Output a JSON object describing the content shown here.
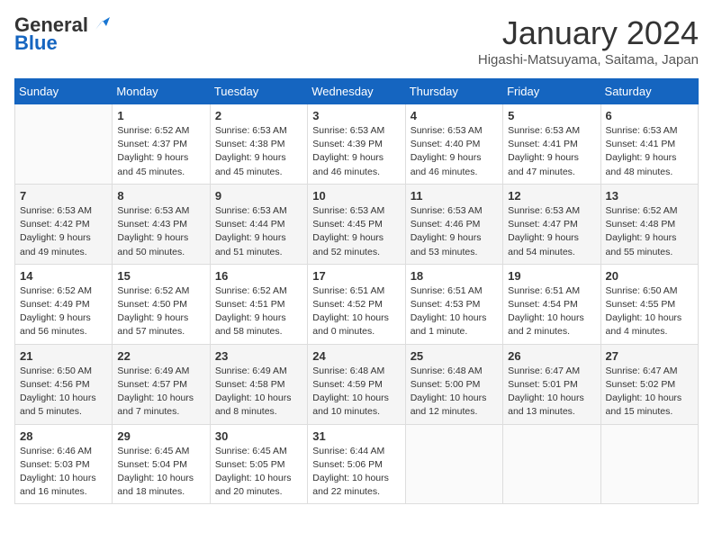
{
  "logo": {
    "line1": "General",
    "line2": "Blue"
  },
  "title": "January 2024",
  "location": "Higashi-Matsuyama, Saitama, Japan",
  "days_of_week": [
    "Sunday",
    "Monday",
    "Tuesday",
    "Wednesday",
    "Thursday",
    "Friday",
    "Saturday"
  ],
  "weeks": [
    [
      {
        "day": "",
        "info": ""
      },
      {
        "day": "1",
        "info": "Sunrise: 6:52 AM\nSunset: 4:37 PM\nDaylight: 9 hours\nand 45 minutes."
      },
      {
        "day": "2",
        "info": "Sunrise: 6:53 AM\nSunset: 4:38 PM\nDaylight: 9 hours\nand 45 minutes."
      },
      {
        "day": "3",
        "info": "Sunrise: 6:53 AM\nSunset: 4:39 PM\nDaylight: 9 hours\nand 46 minutes."
      },
      {
        "day": "4",
        "info": "Sunrise: 6:53 AM\nSunset: 4:40 PM\nDaylight: 9 hours\nand 46 minutes."
      },
      {
        "day": "5",
        "info": "Sunrise: 6:53 AM\nSunset: 4:41 PM\nDaylight: 9 hours\nand 47 minutes."
      },
      {
        "day": "6",
        "info": "Sunrise: 6:53 AM\nSunset: 4:41 PM\nDaylight: 9 hours\nand 48 minutes."
      }
    ],
    [
      {
        "day": "7",
        "info": "Sunrise: 6:53 AM\nSunset: 4:42 PM\nDaylight: 9 hours\nand 49 minutes."
      },
      {
        "day": "8",
        "info": "Sunrise: 6:53 AM\nSunset: 4:43 PM\nDaylight: 9 hours\nand 50 minutes."
      },
      {
        "day": "9",
        "info": "Sunrise: 6:53 AM\nSunset: 4:44 PM\nDaylight: 9 hours\nand 51 minutes."
      },
      {
        "day": "10",
        "info": "Sunrise: 6:53 AM\nSunset: 4:45 PM\nDaylight: 9 hours\nand 52 minutes."
      },
      {
        "day": "11",
        "info": "Sunrise: 6:53 AM\nSunset: 4:46 PM\nDaylight: 9 hours\nand 53 minutes."
      },
      {
        "day": "12",
        "info": "Sunrise: 6:53 AM\nSunset: 4:47 PM\nDaylight: 9 hours\nand 54 minutes."
      },
      {
        "day": "13",
        "info": "Sunrise: 6:52 AM\nSunset: 4:48 PM\nDaylight: 9 hours\nand 55 minutes."
      }
    ],
    [
      {
        "day": "14",
        "info": "Sunrise: 6:52 AM\nSunset: 4:49 PM\nDaylight: 9 hours\nand 56 minutes."
      },
      {
        "day": "15",
        "info": "Sunrise: 6:52 AM\nSunset: 4:50 PM\nDaylight: 9 hours\nand 57 minutes."
      },
      {
        "day": "16",
        "info": "Sunrise: 6:52 AM\nSunset: 4:51 PM\nDaylight: 9 hours\nand 58 minutes."
      },
      {
        "day": "17",
        "info": "Sunrise: 6:51 AM\nSunset: 4:52 PM\nDaylight: 10 hours\nand 0 minutes."
      },
      {
        "day": "18",
        "info": "Sunrise: 6:51 AM\nSunset: 4:53 PM\nDaylight: 10 hours\nand 1 minute."
      },
      {
        "day": "19",
        "info": "Sunrise: 6:51 AM\nSunset: 4:54 PM\nDaylight: 10 hours\nand 2 minutes."
      },
      {
        "day": "20",
        "info": "Sunrise: 6:50 AM\nSunset: 4:55 PM\nDaylight: 10 hours\nand 4 minutes."
      }
    ],
    [
      {
        "day": "21",
        "info": "Sunrise: 6:50 AM\nSunset: 4:56 PM\nDaylight: 10 hours\nand 5 minutes."
      },
      {
        "day": "22",
        "info": "Sunrise: 6:49 AM\nSunset: 4:57 PM\nDaylight: 10 hours\nand 7 minutes."
      },
      {
        "day": "23",
        "info": "Sunrise: 6:49 AM\nSunset: 4:58 PM\nDaylight: 10 hours\nand 8 minutes."
      },
      {
        "day": "24",
        "info": "Sunrise: 6:48 AM\nSunset: 4:59 PM\nDaylight: 10 hours\nand 10 minutes."
      },
      {
        "day": "25",
        "info": "Sunrise: 6:48 AM\nSunset: 5:00 PM\nDaylight: 10 hours\nand 12 minutes."
      },
      {
        "day": "26",
        "info": "Sunrise: 6:47 AM\nSunset: 5:01 PM\nDaylight: 10 hours\nand 13 minutes."
      },
      {
        "day": "27",
        "info": "Sunrise: 6:47 AM\nSunset: 5:02 PM\nDaylight: 10 hours\nand 15 minutes."
      }
    ],
    [
      {
        "day": "28",
        "info": "Sunrise: 6:46 AM\nSunset: 5:03 PM\nDaylight: 10 hours\nand 16 minutes."
      },
      {
        "day": "29",
        "info": "Sunrise: 6:45 AM\nSunset: 5:04 PM\nDaylight: 10 hours\nand 18 minutes."
      },
      {
        "day": "30",
        "info": "Sunrise: 6:45 AM\nSunset: 5:05 PM\nDaylight: 10 hours\nand 20 minutes."
      },
      {
        "day": "31",
        "info": "Sunrise: 6:44 AM\nSunset: 5:06 PM\nDaylight: 10 hours\nand 22 minutes."
      },
      {
        "day": "",
        "info": ""
      },
      {
        "day": "",
        "info": ""
      },
      {
        "day": "",
        "info": ""
      }
    ]
  ]
}
